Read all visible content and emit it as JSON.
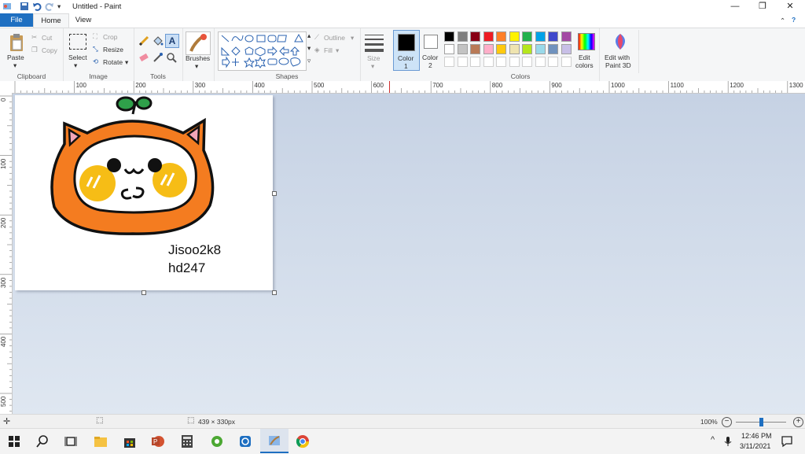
{
  "window": {
    "title": "Untitled - Paint",
    "minimize": "—",
    "restore": "❐",
    "close": "✕"
  },
  "tabs": {
    "file": "File",
    "home": "Home",
    "view": "View"
  },
  "ribbon": {
    "clipboard": {
      "label": "Clipboard",
      "paste": "Paste",
      "cut": "Cut",
      "copy": "Copy"
    },
    "image": {
      "label": "Image",
      "select": "Select",
      "crop": "Crop",
      "resize": "Resize",
      "rotate": "Rotate"
    },
    "tools": {
      "label": "Tools"
    },
    "brushes": {
      "label": "Brushes"
    },
    "shapes": {
      "label": "Shapes",
      "outline": "Outline",
      "fill": "Fill"
    },
    "size": {
      "label": "Size"
    },
    "color1": {
      "label": "Color",
      "sub": "1",
      "color": "#000000"
    },
    "color2": {
      "label": "Color",
      "sub": "2",
      "color": "#ffffff"
    },
    "colors": {
      "label": "Colors",
      "row1": [
        "#000000",
        "#7f7f7f",
        "#880015",
        "#ed1c24",
        "#ff7f27",
        "#fff200",
        "#22b14c",
        "#00a2e8",
        "#3f48cc",
        "#a349a4"
      ],
      "row2": [
        "#ffffff",
        "#c3c3c3",
        "#b97a57",
        "#ffaec9",
        "#ffc90e",
        "#efe4b0",
        "#b5e61d",
        "#99d9ea",
        "#7092be",
        "#c8bfe7"
      ]
    },
    "edit_colors": {
      "line1": "Edit",
      "line2": "colors"
    },
    "paint3d": {
      "line1": "Edit with",
      "line2": "Paint 3D"
    }
  },
  "ruler": {
    "h": [
      "100",
      "200",
      "300",
      "400",
      "500",
      "600",
      "700",
      "800",
      "900",
      "1000",
      "1100",
      "1200",
      "1300"
    ],
    "h_zero": "0",
    "v": [
      "0",
      "100",
      "200",
      "300",
      "400",
      "500"
    ]
  },
  "canvas": {
    "text_line1": "Jisoo2k8",
    "text_line2": "hd247"
  },
  "status": {
    "size": "439 × 330px",
    "zoom": "100%"
  },
  "taskbar": {
    "time": "12:46 PM",
    "date": "3/11/2021"
  }
}
